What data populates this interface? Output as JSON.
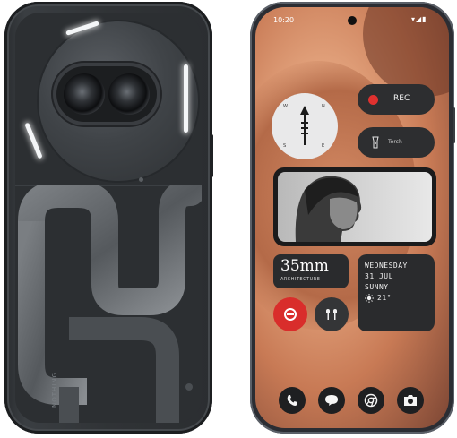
{
  "back_phone": {
    "brand_text": "NOTHING"
  },
  "front_phone": {
    "status_bar": {
      "time": "10:20",
      "icons": "▾◢▮"
    },
    "compass": {
      "north": "N",
      "west": "W",
      "south": "S",
      "east": "E"
    },
    "record": {
      "label": "REC",
      "dot_color": "#e0312f"
    },
    "torch": {
      "label": "Torch",
      "icon": "flashlight-icon"
    },
    "photo": {
      "description_icon": "portrait-photo"
    },
    "lens": {
      "title": "35mm",
      "subtitle": "ARCHITECTURE"
    },
    "weather": {
      "day": "WEDNESDAY",
      "date": "31 JUL",
      "condition": "SUNNY",
      "temperature": "21°",
      "icon": "sun-icon"
    },
    "quick_buttons": [
      {
        "icon": "do-not-disturb-icon",
        "color": "#d92d2b"
      },
      {
        "icon": "earbuds-icon",
        "color": "#343537"
      }
    ],
    "dock": [
      {
        "icon": "phone-icon"
      },
      {
        "icon": "messages-icon"
      },
      {
        "icon": "chrome-icon"
      },
      {
        "icon": "camera-icon"
      }
    ]
  }
}
